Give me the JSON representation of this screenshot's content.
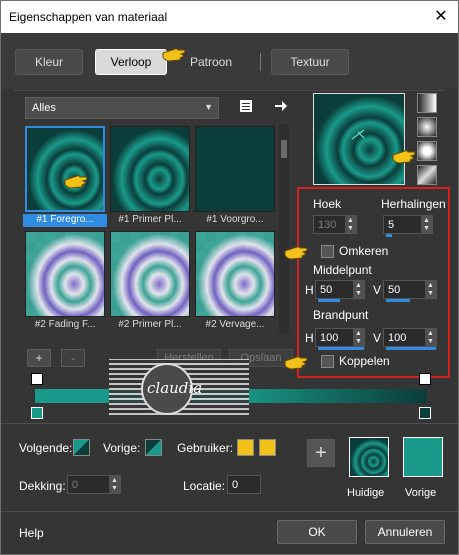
{
  "window": {
    "title": "Eigenschappen van materiaal",
    "close_glyph": "✕"
  },
  "tabs": [
    {
      "label": "Kleur",
      "active": false
    },
    {
      "label": "Verloop",
      "active": true
    },
    {
      "label": "Patroon",
      "active": false
    },
    {
      "label": "Textuur",
      "active": false
    }
  ],
  "gallery": {
    "category": "Alles",
    "items": [
      {
        "caption": "#1 Foregro...",
        "selected": true
      },
      {
        "caption": "#1 Primer Pl...",
        "selected": false
      },
      {
        "caption": "#1 Voorgro...",
        "selected": false
      },
      {
        "caption": "#2 Fading F...",
        "selected": false
      },
      {
        "caption": "#2 Primer Pl...",
        "selected": false
      },
      {
        "caption": "#2 Vervage...",
        "selected": false
      }
    ],
    "add_label": "+",
    "remove_label": "-",
    "restore_label": "Herstellen",
    "save_label": "Opslaan"
  },
  "settings": {
    "angle_label": "Hoek",
    "angle_value": "130",
    "repeats_label": "Herhalingen",
    "repeats_value": "5",
    "invert_label": "Omkeren",
    "midpoint_label": "Middelpunt",
    "midpoint_h_label": "H",
    "midpoint_h": "50",
    "midpoint_v_label": "V",
    "midpoint_v": "50",
    "focal_label": "Brandpunt",
    "focal_h_label": "H",
    "focal_h": "100",
    "focal_v_label": "V",
    "focal_v": "100",
    "link_label": "Koppelen"
  },
  "watermark": {
    "text": "claudia"
  },
  "bottom": {
    "next_label": "Volgende:",
    "prev_label": "Vorige:",
    "user_label": "Gebruiker:",
    "opacity_label": "Dekking:",
    "opacity_value": "0",
    "location_label": "Locatie:",
    "location_value": "0",
    "current_label": "Huidige",
    "previous_label": "Vorige",
    "add_swatch_label": "+"
  },
  "footer": {
    "help_label": "Help",
    "ok_label": "OK",
    "cancel_label": "Annuleren"
  },
  "colors": {
    "teal": "#1a9a8a",
    "dark_teal": "#0b3d3a",
    "gold": "#f2c21b",
    "accent_blue": "#2f8ce0",
    "highlight_red": "#d21f1f"
  }
}
